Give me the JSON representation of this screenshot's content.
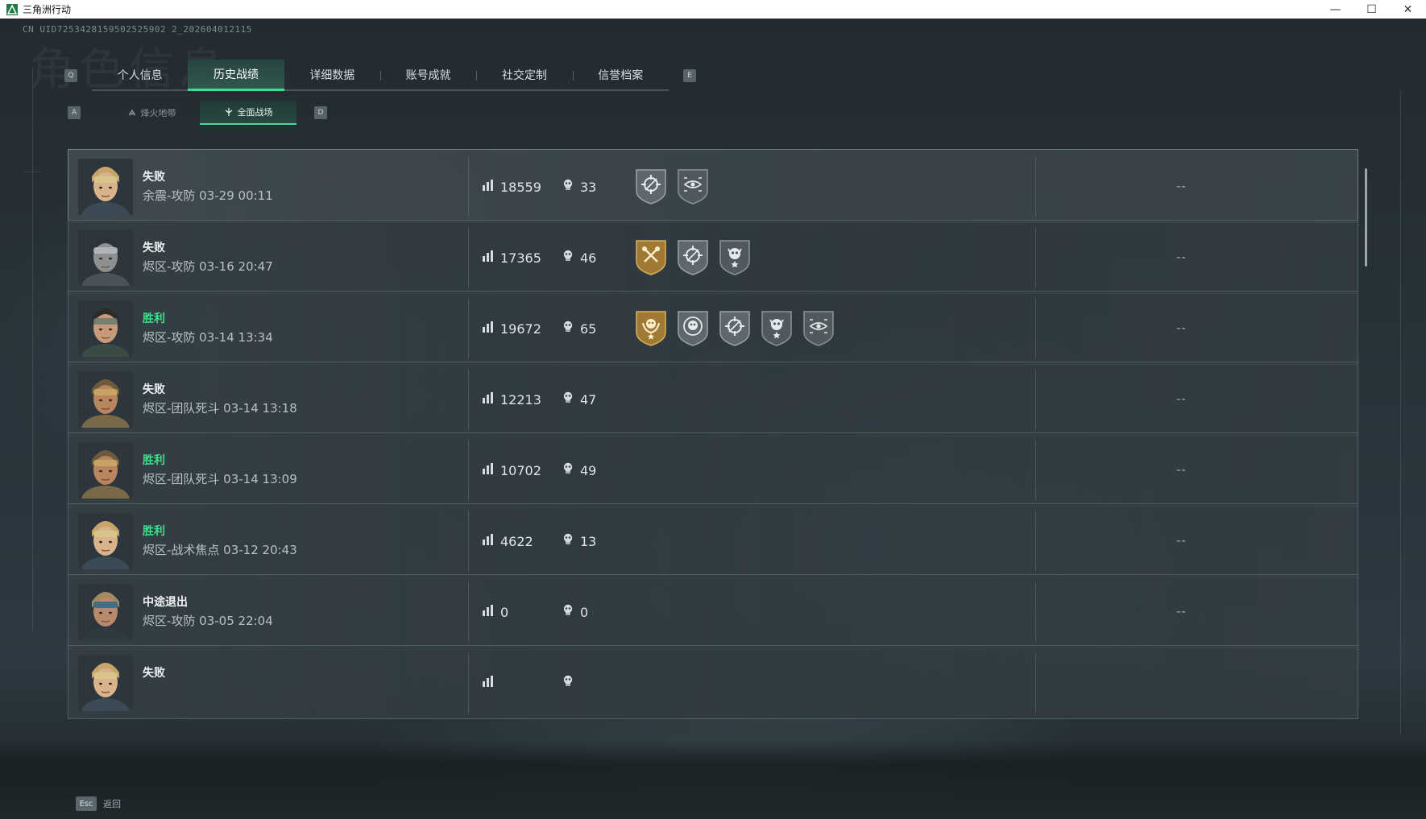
{
  "window": {
    "title": "三角洲行动",
    "controls": {
      "minimize": "—",
      "maximize": "☐",
      "close": "✕"
    }
  },
  "uid": "CN UID7253428159502525902 2_202604012115",
  "watermark": "角色信息",
  "tabs": {
    "left_key": "Q",
    "right_key": "E",
    "items": [
      {
        "label": "个人信息",
        "active": false
      },
      {
        "label": "历史战绩",
        "active": true
      },
      {
        "label": "详细数据",
        "active": false
      },
      {
        "label": "账号成就",
        "active": false
      },
      {
        "label": "社交定制",
        "active": false
      },
      {
        "label": "信誉档案",
        "active": false
      }
    ]
  },
  "subtabs": {
    "left_key": "A",
    "right_key": "D",
    "items": [
      {
        "label": "烽火地带",
        "icon": "extraction-icon",
        "active": false
      },
      {
        "label": "全面战场",
        "icon": "warfare-icon",
        "active": true
      }
    ]
  },
  "accent_color": "#3de08c",
  "matches": [
    {
      "result": "失败",
      "win": false,
      "mode": "余震-攻防 03-29 00:11",
      "score": "18559",
      "kills": "33",
      "avatar": "operator-female-goggles",
      "medals": [
        "gray-crosshair",
        "gray-eye"
      ],
      "extra": "--"
    },
    {
      "result": "失败",
      "win": false,
      "mode": "烬区-攻防 03-16 20:47",
      "score": "17365",
      "kills": "46",
      "avatar": "operator-hood-mask",
      "medals": [
        "gold-tools",
        "gray-crosshair",
        "gray-skull-star"
      ],
      "extra": "--"
    },
    {
      "result": "胜利",
      "win": true,
      "mode": "烬区-攻防 03-14 13:34",
      "score": "19672",
      "kills": "65",
      "avatar": "operator-female-hood",
      "medals": [
        "gold-wreath",
        "gray-skull-target",
        "gray-crosshair",
        "gray-skull-star",
        "gray-eye"
      ],
      "extra": "--"
    },
    {
      "result": "失败",
      "win": false,
      "mode": "烬区-团队死斗 03-14 13:18",
      "score": "12213",
      "kills": "47",
      "avatar": "operator-crown-helmet",
      "medals": [],
      "extra": "--"
    },
    {
      "result": "胜利",
      "win": true,
      "mode": "烬区-团队死斗 03-14 13:09",
      "score": "10702",
      "kills": "49",
      "avatar": "operator-crown-helmet",
      "medals": [],
      "extra": "--"
    },
    {
      "result": "胜利",
      "win": true,
      "mode": "烬区-战术焦点 03-12 20:43",
      "score": "4622",
      "kills": "13",
      "avatar": "operator-female-goggles",
      "medals": [],
      "extra": "--"
    },
    {
      "result": "中途退出",
      "win": false,
      "mode": "烬区-攻防 03-05 22:04",
      "score": "0",
      "kills": "0",
      "avatar": "operator-headset-male",
      "medals": [],
      "extra": "--"
    },
    {
      "result": "失败",
      "win": false,
      "mode": "",
      "score": "",
      "kills": "",
      "avatar": "operator-female-goggles",
      "medals": [],
      "extra": ""
    }
  ],
  "footer": {
    "key": "Esc",
    "label": "返回"
  }
}
